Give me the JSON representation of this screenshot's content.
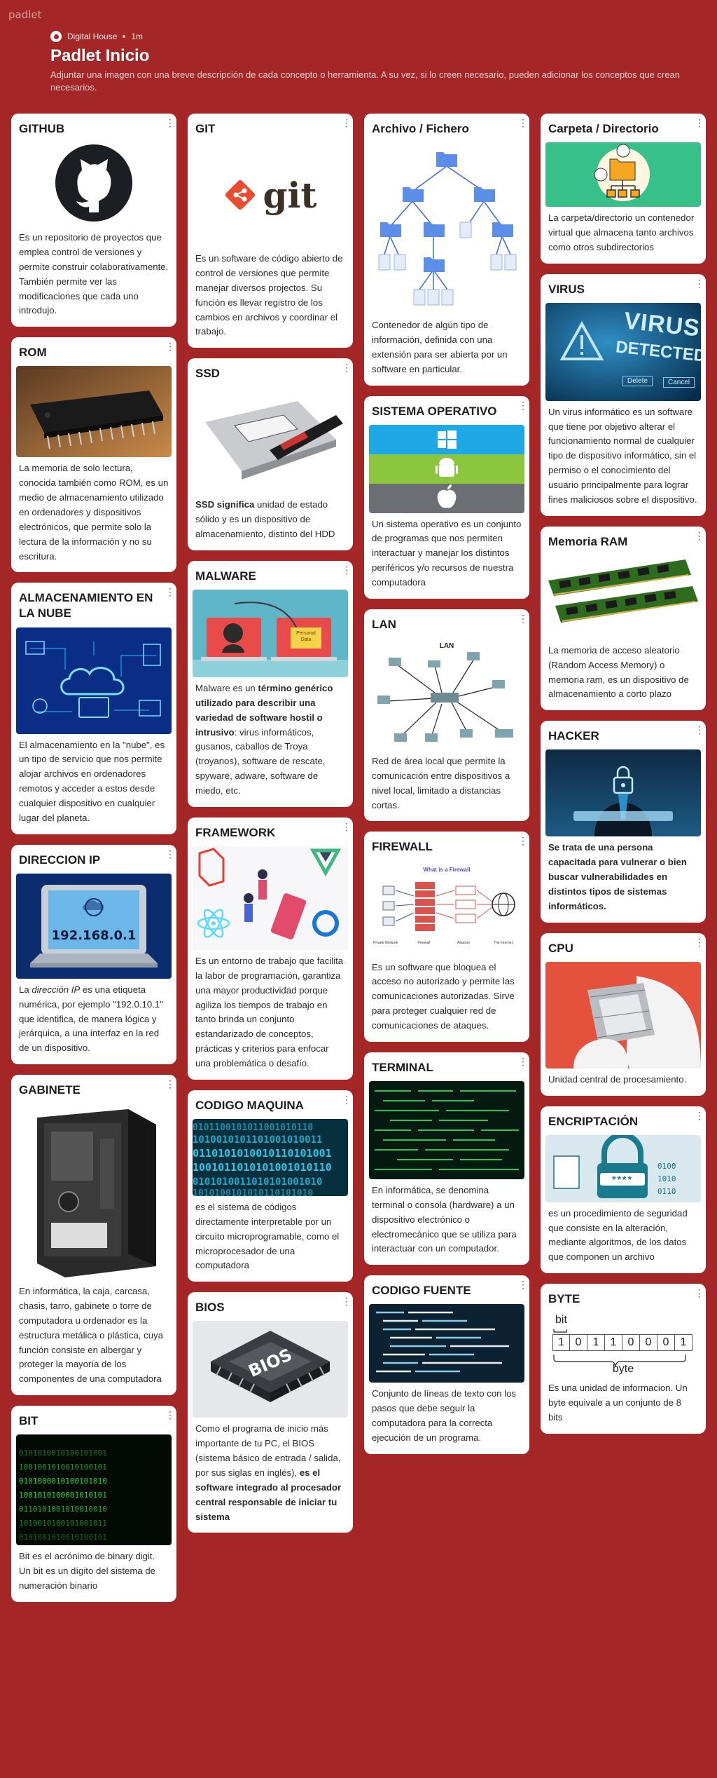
{
  "app": {
    "brand": "padlet"
  },
  "header": {
    "author": "Digital House",
    "time": "1m",
    "title": "Padlet Inicio",
    "description": "Adjuntar una imagen con una breve descripción de cada concepto o herramienta. A su vez, si lo creen necesario, pueden adicionar los conceptos que crean necesarios."
  },
  "cards": {
    "github": {
      "title": "GITHUB",
      "body": "Es un repositorio de proyectos que emplea control de versiones y permite construir colaborativamente. También permite ver las modificaciones que cada uno introdujo."
    },
    "rom": {
      "title": "ROM",
      "body": "La memoria de solo lectura, conocida también como ROM, es un medio de almacenamiento utilizado en ordenadores y dispositivos electrónicos, que permite solo la lectura de la información y no su escritura."
    },
    "nube": {
      "title": "ALMACENAMIENTO EN LA NUBE",
      "body": "El almacenamiento en la \"nube\", es un tipo de servicio que nos permite alojar archivos en ordenadores remotos y acceder a estos desde cualquier dispositivo en cualquier lugar del planeta."
    },
    "ip": {
      "title": "DIRECCION IP",
      "screen": "192.168.0.1",
      "body_italic": "dirección IP",
      "body_pre": "La ",
      "body_post": " es una etiqueta numérica, por ejemplo \"192.0.10.1\" que identifica, de manera lógica y jerárquica, a una interfaz en la red de un dispositivo."
    },
    "gabinete": {
      "title": "GABINETE",
      "body": "En informática, la caja, carcasa, chasis, tarro, gabinete o torre de computadora u ordenador es la estructura metálica o plástica, cuya función consiste en albergar y proteger la mayoría de los componentes de una computadora"
    },
    "bit": {
      "title": "BIT",
      "body": "Bit es el acrónimo de binary digit. Un bit es un dígito del sistema de numeración binario"
    },
    "git": {
      "title": "GIT",
      "logo": "git",
      "body": "Es un software de código abierto de control de versiones que permite manejar diversos projectos. Su función es llevar registro de los cambios en archivos y coordinar el trabajo."
    },
    "ssd": {
      "title": "SSD",
      "body_bold": "SSD significa",
      "body_rest": " unidad de estado sólido y es un dispositivo de almacenamiento, distinto del HDD"
    },
    "malware": {
      "title": "MALWARE",
      "label": "Personal Data",
      "body_pre": "Malware es un ",
      "body_bold": "término genérico utilizado para describir una variedad de software hostil o intrusivo",
      "body_post": ": virus informáticos, gusanos, caballos de Troya (troyanos), software de rescate, spyware, adware, software de miedo, etc."
    },
    "framework": {
      "title": "FRAMEWORK",
      "body": "Es un entorno de trabajo que facilita la labor de programación, garantiza una mayor productividad porque agiliza los tiempos de trabajo en tanto brinda un conjunto estandarizado de conceptos, prácticas y criterios para enfocar una problemática o desafío."
    },
    "codigomaquina": {
      "title": "CODIGO MAQUINA",
      "body": "es el sistema de códigos directamente interpretable por un circuito microprogramable, como el microprocesador de una computadora"
    },
    "bios": {
      "title": "BIOS",
      "chip": "BIOS",
      "body_pre": "Como el programa de inicio más importante de tu PC, el BIOS (sistema básico de entrada / salida, por sus siglas en inglés), ",
      "body_bold": "es el software integrado al procesador central responsable de iniciar tu sistema"
    },
    "archivo": {
      "title": "Archivo / Fichero",
      "body": "Contenedor de algún tipo de información, definida con una extensión para ser abierta por un software en particular."
    },
    "so": {
      "title": "SISTEMA OPERATIVO",
      "body": "Un sistema operativo es un conjunto de programas que nos permiten interactuar y manejar los distintos periféricos y/o recursos de nuestra computadora"
    },
    "lan": {
      "title": "LAN",
      "diagram_label": "LAN",
      "body": "Red de área local que permite la comunicación entre dispositivos a nivel local, limitado a distancias cortas."
    },
    "firewall": {
      "title": "FIREWALL",
      "diagram_title": "What is a Firewall",
      "labels": [
        "Private Network",
        "Firewall",
        "Attacker",
        "The Internet"
      ],
      "body": "Es un software que bloquea el acceso no autorizado y permite las comunicaciones autorizadas. Sirve para proteger cualquier red de comunicaciones de ataques."
    },
    "terminal": {
      "title": "TERMINAL",
      "body": "En informática, se denomina terminal o consola (hardware) a un dispositivo electrónico o electromecánico que se utiliza para interactuar con un computador."
    },
    "codigofuente": {
      "title": "CODIGO FUENTE",
      "body": "Conjunto de líneas de texto con los pasos que debe seguir la computadora para la correcta ejecución de un programa."
    },
    "carpeta": {
      "title": "Carpeta / Directorio",
      "body": "La carpeta/directorio un contenedor virtual que almacena tanto archivos como otros subdirectorios"
    },
    "virus": {
      "title": "VIRUS",
      "img_text": [
        "VIRUS",
        "DETECTED"
      ],
      "buttons": [
        "Delete",
        "Cancel"
      ],
      "body": "Un virus informático es un software que tiene por objetivo alterar el funcionamiento normal de cualquier tipo de dispositivo informático, sin el permiso o el conocimiento del usuario principalmente para lograr fines maliciosos sobre el dispositivo."
    },
    "ram": {
      "title": "Memoria RAM",
      "body": "La memoria de acceso aleatorio (Random Access Memory) o memoria ram, es un dispositivo de almacenamiento a corto plazo"
    },
    "hacker": {
      "title": "HACKER",
      "body": "Se trata de una persona capacitada para vulnerar o bien buscar vulnerabilidades en distintos tipos de sistemas informáticos."
    },
    "cpu": {
      "title": "CPU",
      "body": "Unidad central de procesamiento."
    },
    "encriptacion": {
      "title": "ENCRIPTACIÓN",
      "img_text": "****",
      "body": "es un procedimiento de seguridad que consiste en la alteración, mediante algoritmos, de los datos que componen un archivo"
    },
    "byte": {
      "title": "BYTE",
      "bits": [
        "1",
        "0",
        "1",
        "1",
        "0",
        "0",
        "0",
        "1"
      ],
      "bit_label": "bit",
      "byte_label": "byte",
      "body": "Es una unidad de informacion. Un byte equivale a un conjunto de 8 bits"
    }
  },
  "colors": {
    "background": "#a42627",
    "card": "#ffffff"
  }
}
